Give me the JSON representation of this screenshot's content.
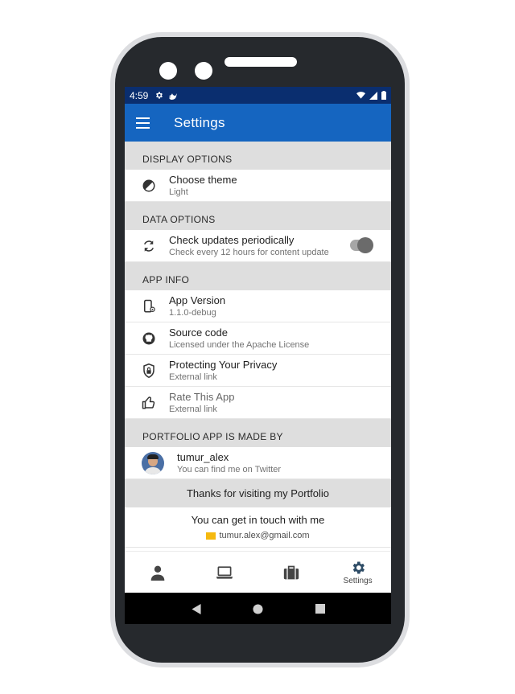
{
  "status_bar": {
    "time": "4:59"
  },
  "app_bar": {
    "title": "Settings"
  },
  "sections": {
    "display": {
      "header": "DISPLAY OPTIONS",
      "theme": {
        "title": "Choose theme",
        "subtitle": "Light"
      }
    },
    "data": {
      "header": "DATA OPTIONS",
      "updates": {
        "title": "Check updates periodically",
        "subtitle": "Check every 12 hours for content update",
        "toggle_on": true
      }
    },
    "app_info": {
      "header": "APP INFO",
      "version": {
        "title": "App Version",
        "subtitle": "1.1.0-debug"
      },
      "source": {
        "title": "Source code",
        "subtitle": "Licensed under the Apache License"
      },
      "privacy": {
        "title": "Protecting Your Privacy",
        "subtitle": "External link"
      },
      "rate": {
        "title": "Rate This App",
        "subtitle": "External link"
      }
    },
    "made_by": {
      "header": "PORTFOLIO APP IS MADE BY",
      "author": {
        "title": "tumur_alex",
        "subtitle": "You can find me on Twitter"
      }
    }
  },
  "footer": {
    "thanks": "Thanks for visiting my Portfolio",
    "touch": "You can get in touch with me",
    "email": "tumur.alex@gmail.com"
  },
  "bottom_nav": {
    "items": [
      {
        "icon": "person-icon",
        "label": ""
      },
      {
        "icon": "laptop-icon",
        "label": ""
      },
      {
        "icon": "briefcase-icon",
        "label": ""
      },
      {
        "icon": "gear-icon",
        "label": "Settings"
      }
    ],
    "active_index": 3
  },
  "colors": {
    "primary": "#1565c0",
    "status_bar": "#0a2e6f",
    "section_bg": "#dedede",
    "email_icon": "#f5b90f"
  }
}
